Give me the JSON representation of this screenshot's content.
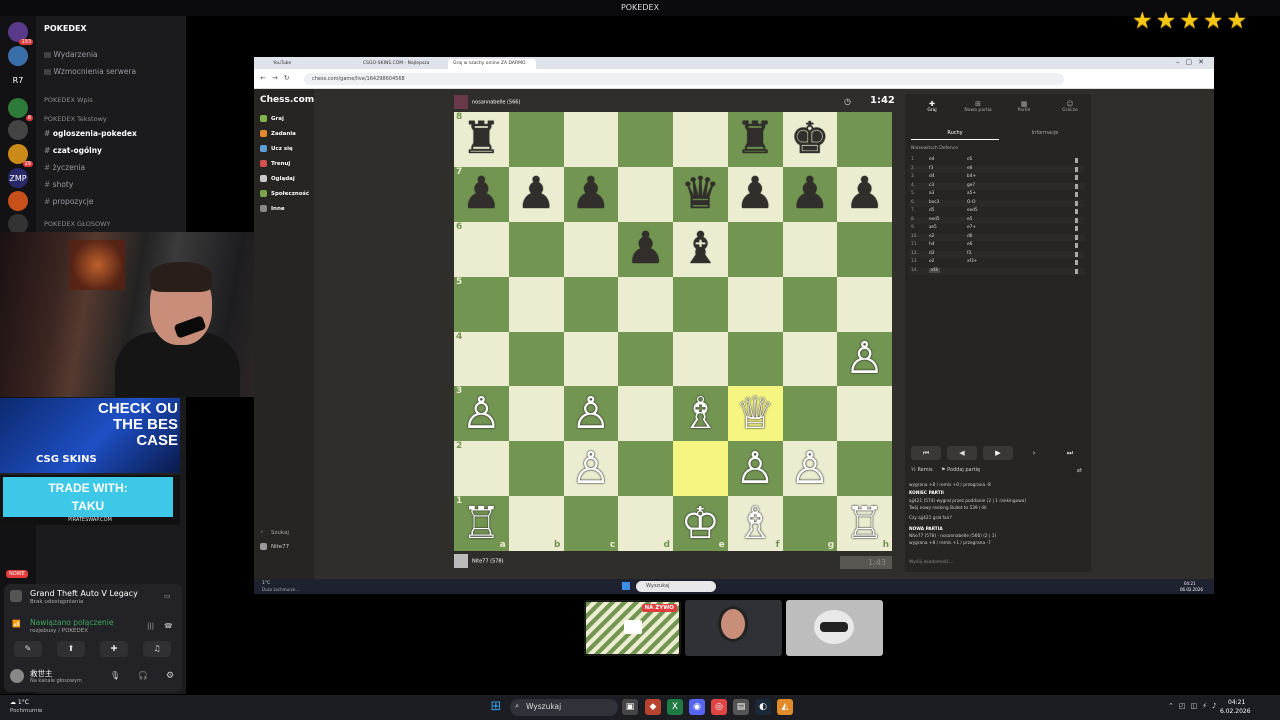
{
  "window_title": "POKEDEX",
  "rating_stars": 5,
  "servers": [
    {
      "label": "",
      "badge": "193",
      "color": "#5a3a8a"
    },
    {
      "label": "",
      "badge": "",
      "color": "#3a6ea8"
    },
    {
      "label": "R7",
      "badge": "",
      "color": "#121214"
    },
    {
      "label": "",
      "badge": "8",
      "color": "#2d7a3a"
    },
    {
      "label": "",
      "badge": "",
      "color": "#444"
    },
    {
      "label": "",
      "badge": "29",
      "color": "#c98a1a"
    },
    {
      "label": "ZMP",
      "badge": "",
      "color": "#2a2a6a"
    },
    {
      "label": "",
      "badge": "",
      "color": "#c8501a"
    },
    {
      "label": "",
      "badge": "",
      "color": "#333"
    }
  ],
  "channels": {
    "server_name": "POKEDEX",
    "items": [
      {
        "label": "Wydarzenia",
        "kind": "item"
      },
      {
        "label": "Wzmocnienia serwera",
        "kind": "item"
      },
      {
        "label": "POKEDEX Wpis",
        "kind": "cat"
      },
      {
        "label": "POKEDEX Tekstowy",
        "kind": "cat"
      },
      {
        "label": "ogloszenia-pokedex",
        "kind": "bold"
      },
      {
        "label": "czat-ogólny",
        "kind": "bold"
      },
      {
        "label": "życzenia",
        "kind": "item"
      },
      {
        "label": "shoty",
        "kind": "item"
      },
      {
        "label": "propozycje",
        "kind": "item"
      },
      {
        "label": "POKEDEX GŁOSOWY",
        "kind": "cat"
      }
    ]
  },
  "ad": {
    "check_text": "CHECK OU THE BES CASE",
    "brand": "CSG SKINS",
    "trade": "TRADE WITH:",
    "trade_name": "TAKU",
    "site": "PIRATESWAP.COM"
  },
  "live_badge": "NOWE",
  "discord_panel": {
    "activity_title": "Grand Theft Auto V Legacy",
    "activity_sub": "Brak udostępniania",
    "voice_status": "Nawiązano połączenie",
    "voice_channel": "rozjebusy / POKEDEX",
    "username": "救世主",
    "user_status": "Na kanale głosowym"
  },
  "browser": {
    "tabs": [
      {
        "label": "YouTube"
      },
      {
        "label": "CSGO-SKINS.COM - Najlepsza"
      },
      {
        "label": "Graj w szachy online ZA DARMO"
      }
    ],
    "url": "chess.com/game/live/164298604568"
  },
  "chess_nav": {
    "logo": "Chess.com",
    "items": [
      {
        "label": "Graj",
        "color": "#81b64c"
      },
      {
        "label": "Zadania",
        "color": "#e38b2c"
      },
      {
        "label": "Ucz się",
        "color": "#5d9fd6"
      },
      {
        "label": "Trenuj",
        "color": "#d65151"
      },
      {
        "label": "Oglądaj",
        "color": "#c9c9c9"
      },
      {
        "label": "Społeczność",
        "color": "#7aa34a"
      },
      {
        "label": "Inne",
        "color": "#888"
      }
    ],
    "search": "Szukaj",
    "user": "Nite77"
  },
  "game": {
    "top_player": "nosannabelle (566)",
    "top_clock": "1:42",
    "bottom_player": "Nite77 (578)",
    "bottom_clock": "1:43",
    "ranks": [
      "8",
      "7",
      "6",
      "5",
      "4",
      "3",
      "2",
      "1"
    ],
    "files": [
      "a",
      "b",
      "c",
      "d",
      "e",
      "f",
      "g",
      "h"
    ],
    "highlight": [
      "f3",
      "e2"
    ],
    "board": [
      [
        "br",
        "",
        "",
        "",
        "",
        "br",
        "bk",
        ""
      ],
      [
        "bp",
        "bp",
        "bp",
        "",
        "bq",
        "bp",
        "bp",
        "bp"
      ],
      [
        "",
        "",
        "",
        "bp",
        "bb",
        "",
        "",
        ""
      ],
      [
        "",
        "",
        "",
        "",
        "",
        "",
        "",
        ""
      ],
      [
        "",
        "",
        "",
        "",
        "",
        "",
        "",
        "wp"
      ],
      [
        "wp",
        "",
        "wp",
        "",
        "wb",
        "wq",
        "",
        ""
      ],
      [
        "",
        "",
        "wp",
        "",
        "",
        "wp",
        "wp",
        ""
      ],
      [
        "wr",
        "",
        "",
        "",
        "wk",
        "wb",
        "",
        "wr"
      ]
    ]
  },
  "side": {
    "tab_labels": [
      "Graj",
      "Nowa partia",
      "Partie",
      "Gracze"
    ],
    "sub_tabs": [
      "Ruchy",
      "Informacje"
    ],
    "opening": "Niezowitsch Defence",
    "moves": [
      {
        "n": "1.",
        "w": "e4",
        "b": "c6"
      },
      {
        "n": "2.",
        "w": "f3",
        "b": "e6"
      },
      {
        "n": "3.",
        "w": "d4",
        "b": "b4+"
      },
      {
        "n": "4.",
        "w": "c3",
        "b": "ge7"
      },
      {
        "n": "5.",
        "w": "a3",
        "b": "a5+"
      },
      {
        "n": "6.",
        "w": "bxc3",
        "b": "O-O"
      },
      {
        "n": "7.",
        "w": "d5",
        "b": "exd5"
      },
      {
        "n": "8.",
        "w": "exd5",
        "b": "e5"
      },
      {
        "n": "9.",
        "w": "xe5",
        "b": "e7+"
      },
      {
        "n": "10.",
        "w": "e2",
        "b": "d6"
      },
      {
        "n": "11.",
        "w": "h4",
        "b": "e6"
      },
      {
        "n": "12.",
        "w": "d3",
        "b": "f3"
      },
      {
        "n": "13.",
        "w": "e2",
        "b": "xf3+"
      },
      {
        "n": "14.",
        "w": "xf3",
        "b": ""
      }
    ],
    "actions": [
      "Remis",
      "Poddaj partię"
    ],
    "log": [
      "wygrana +8 / remis +0 / przegrana -8",
      "KONIEC PARTII",
      "ajj421 (574) wygrał przez poddanie (2 | 1 rankingowa)",
      "Twój nowy ranking Bullet to 539 (-8)",
      "Czy ajj421 grał fair?",
      "NOWA PARTIA",
      "Nite77 (578) · nosannabelle (566) (2 | 1)",
      "wygrana +8 / remis +1 / przegrana -7"
    ],
    "chat_placeholder": "Wyślij wiadomość..."
  },
  "inner_taskbar": {
    "weather": "1°C",
    "weather_sub": "Dużo zachmurze...",
    "search": "Wyszukaj",
    "time": "04:21",
    "date": "06.02.2026"
  },
  "thumbs": [
    {
      "label": "NA ŻYWO"
    },
    {
      "label": ""
    },
    {
      "label": ""
    }
  ],
  "taskbar": {
    "weather": "1°C",
    "weather_sub": "Pochmurnie",
    "search": "Wyszukaj",
    "time": "04:21",
    "date": "6.02.2026"
  }
}
